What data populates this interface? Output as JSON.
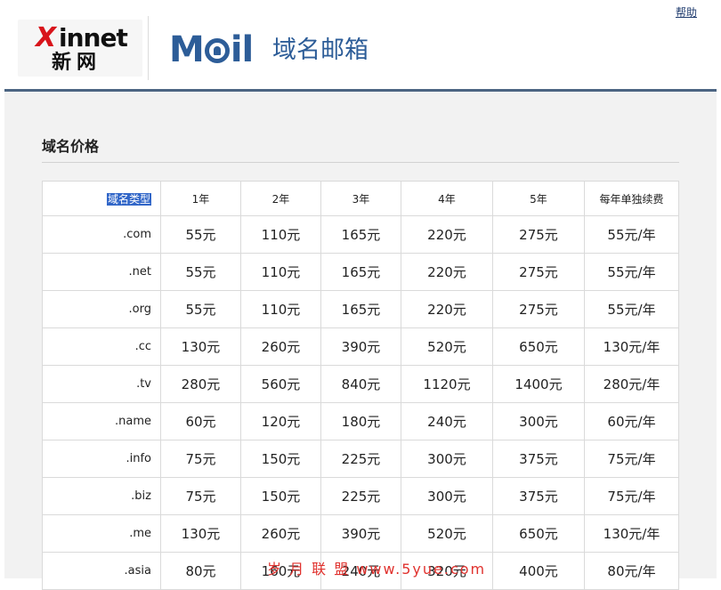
{
  "header": {
    "help_label": "帮助",
    "brand_logo": {
      "x_letter": "X",
      "rest": "innet",
      "cn": "新网"
    },
    "mail_logo": {
      "m": "M",
      "rest": "il",
      "icon": "bell-icon"
    },
    "mail_title": "域名邮箱"
  },
  "section": {
    "title": "域名价格"
  },
  "table": {
    "headers": [
      "域名类型",
      "1年",
      "2年",
      "3年",
      "4年",
      "5年",
      "每年单独续费"
    ],
    "rows": [
      [
        ".com",
        "55元",
        "110元",
        "165元",
        "220元",
        "275元",
        "55元/年"
      ],
      [
        ".net",
        "55元",
        "110元",
        "165元",
        "220元",
        "275元",
        "55元/年"
      ],
      [
        ".org",
        "55元",
        "110元",
        "165元",
        "220元",
        "275元",
        "55元/年"
      ],
      [
        ".cc",
        "130元",
        "260元",
        "390元",
        "520元",
        "650元",
        "130元/年"
      ],
      [
        ".tv",
        "280元",
        "560元",
        "840元",
        "1120元",
        "1400元",
        "280元/年"
      ],
      [
        ".name",
        "60元",
        "120元",
        "180元",
        "240元",
        "300元",
        "60元/年"
      ],
      [
        ".info",
        "75元",
        "150元",
        "225元",
        "300元",
        "375元",
        "75元/年"
      ],
      [
        ".biz",
        "75元",
        "150元",
        "225元",
        "300元",
        "375元",
        "75元/年"
      ],
      [
        ".me",
        "130元",
        "260元",
        "390元",
        "520元",
        "650元",
        "130元/年"
      ],
      [
        ".asia",
        "80元",
        "160元",
        "240元",
        "320元",
        "400元",
        "80元/年"
      ]
    ]
  },
  "watermark": "岁 月 联 盟  www.5yue.com",
  "colors": {
    "brand_red": "#d8141b",
    "mail_blue": "#2d5d98",
    "header_rule": "#4c6582",
    "selection": "#3166c8",
    "content_bg": "#f2f2f2"
  }
}
